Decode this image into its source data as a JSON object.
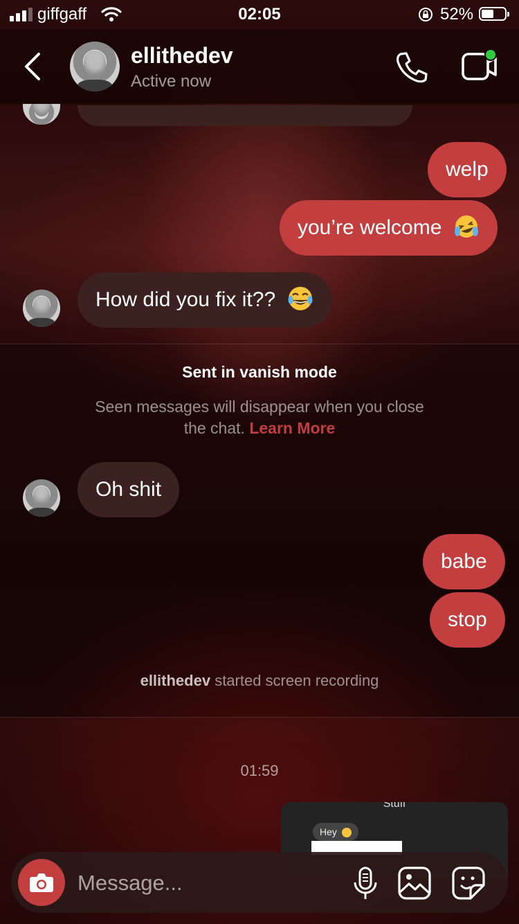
{
  "status_bar": {
    "carrier": "giffgaff",
    "time": "02:05",
    "battery_percent": "52%",
    "battery_level": 0.52
  },
  "header": {
    "back_icon": "chevron-left-icon",
    "username": "ellithedev",
    "status": "Active now",
    "call_icon": "phone-icon",
    "video_icon": "video-camera-icon",
    "online_indicator_color": "#2ecc40"
  },
  "messages": [
    {
      "direction": "received",
      "text": "",
      "partially_hidden": true
    },
    {
      "direction": "sent",
      "text": "welp"
    },
    {
      "direction": "sent",
      "text": "you’re welcome",
      "emoji": "crying-laughing-emoji"
    },
    {
      "direction": "received",
      "text": "How did you fix it??",
      "emoji": "joy-emoji"
    }
  ],
  "vanish_notice": {
    "title": "Sent in vanish mode",
    "text": "Seen messages will disappear when you close the chat.",
    "link": "Learn More"
  },
  "vanish_messages": [
    {
      "direction": "received",
      "text": "Oh shit"
    },
    {
      "direction": "sent",
      "text": "babe"
    },
    {
      "direction": "sent",
      "text": "stop"
    }
  ],
  "system_message": {
    "user": "ellithedev",
    "text": "started screen recording"
  },
  "timestamp": "01:59",
  "preview": {
    "title": "Stuff",
    "bubble_text": "Hey"
  },
  "composer": {
    "camera_icon": "camera-icon",
    "placeholder": "Message...",
    "mic_icon": "microphone-icon",
    "gallery_icon": "image-icon",
    "sticker_icon": "sticker-icon"
  },
  "colors": {
    "sent_bubble": "#c23e3f",
    "received_bubble": "#3c2121",
    "accent": "#c13e3f"
  }
}
